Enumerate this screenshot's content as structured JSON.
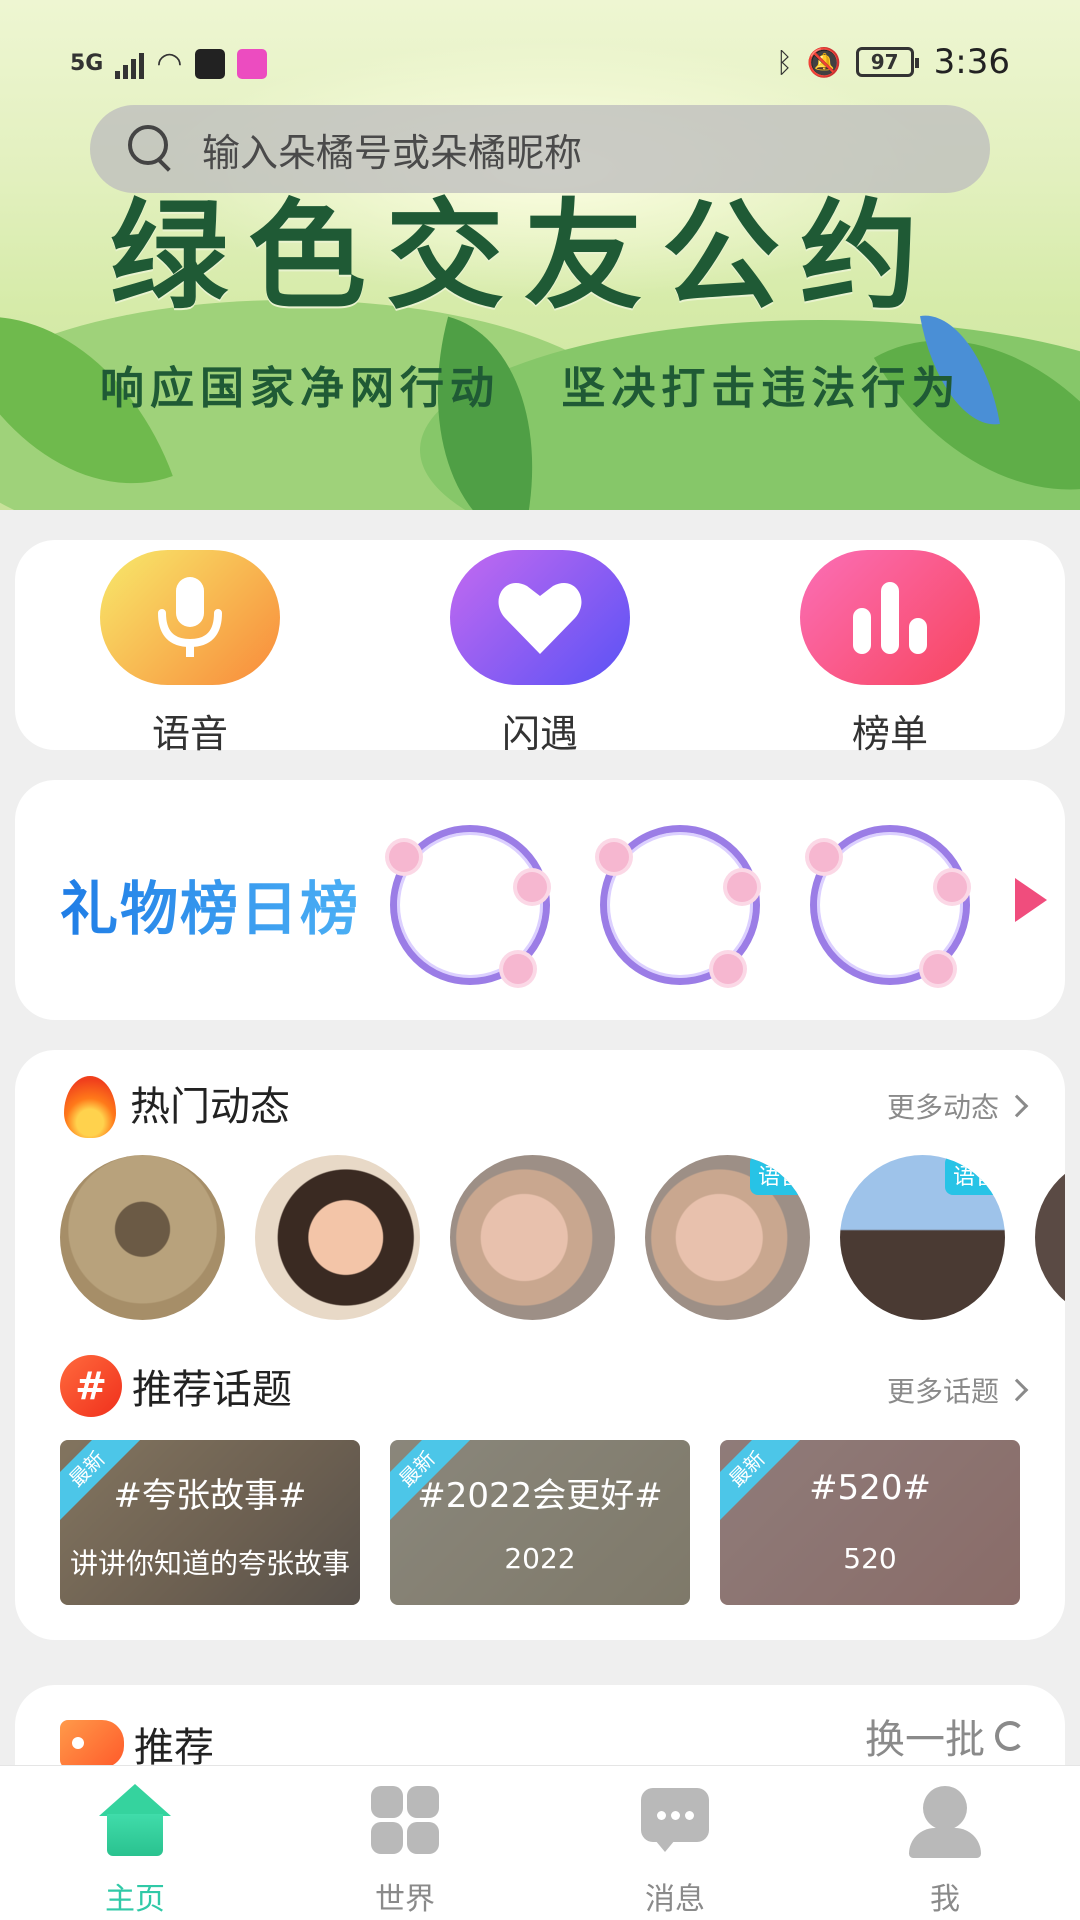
{
  "status_bar": {
    "network": "5G",
    "battery": "97",
    "time": "3:36"
  },
  "search": {
    "placeholder": "输入朵橘号或朵橘昵称"
  },
  "banner": {
    "headline": "绿色交友公约",
    "slogan": "响应国家净网行动 坚决打击违法行为"
  },
  "quick_entries": [
    {
      "label": "语音",
      "icon": "microphone-icon",
      "color": "#f9a23f"
    },
    {
      "label": "闪遇",
      "icon": "heart-icon",
      "color": "#7a5cf5"
    },
    {
      "label": "榜单",
      "icon": "bar-chart-icon",
      "color": "#f7527d"
    }
  ],
  "gift_rank": {
    "title": "礼物榜日榜"
  },
  "hot_posts": {
    "title": "热门动态",
    "more": "更多动态",
    "avatars": [
      {
        "tag": ""
      },
      {
        "tag": ""
      },
      {
        "tag": ""
      },
      {
        "tag": "语音"
      },
      {
        "tag": "语音"
      }
    ]
  },
  "topics": {
    "title": "推荐话题",
    "more": "更多话题",
    "items": [
      {
        "ribbon": "最新",
        "title": "#夸张故事#",
        "subtitle": "讲讲你知道的夸张故事"
      },
      {
        "ribbon": "最新",
        "title": "#2022会更好#",
        "subtitle": "2022"
      },
      {
        "ribbon": "最新",
        "title": "#520#",
        "subtitle": "520"
      }
    ]
  },
  "recommend": {
    "title": "推荐",
    "refresh": "换一批"
  },
  "bottom_nav": [
    {
      "label": "主页",
      "icon": "home-icon",
      "active": true
    },
    {
      "label": "世界",
      "icon": "grid-icon",
      "active": false
    },
    {
      "label": "消息",
      "icon": "message-icon",
      "active": false
    },
    {
      "label": "我",
      "icon": "profile-icon",
      "active": false
    }
  ]
}
